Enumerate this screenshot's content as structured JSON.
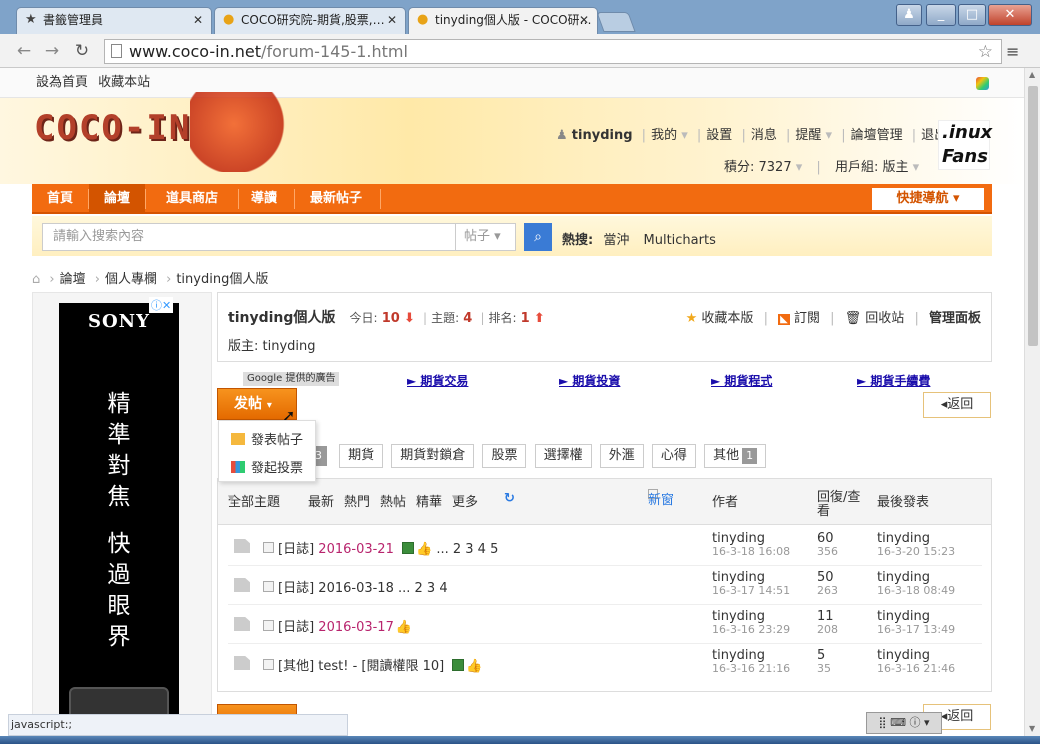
{
  "browser": {
    "tabs": [
      {
        "label": "書籤管理員",
        "icon": "star-icon"
      },
      {
        "label": "COCO研究院-期貨,股票,…",
        "icon": "coco-icon"
      },
      {
        "label": "tinyding個人版 - COCO研…",
        "icon": "coco-icon"
      }
    ],
    "url_host": "www.coco-in.net",
    "url_path": "/forum-145-1.html",
    "status_text": "javascript:;"
  },
  "topbar": {
    "set_home": "設為首頁",
    "bookmark": "收藏本站"
  },
  "header": {
    "logo": "COCO-IN",
    "user": "tinyding",
    "links": [
      "我的",
      "設置",
      "消息",
      "提醒",
      "論壇管理",
      "退出"
    ],
    "points": "積分: 7327",
    "group": "用戶組: 版主",
    "side_badge_1": ".inux",
    "side_badge_2": "Fans"
  },
  "nav": {
    "items": [
      "首頁",
      "論壇",
      "道具商店",
      "導讀",
      "最新帖子"
    ],
    "quick": "快捷導航"
  },
  "search": {
    "placeholder": "請輸入搜索內容",
    "type": "帖子",
    "hot_label": "熱搜:",
    "hot_items": [
      "當沖",
      "Multicharts"
    ]
  },
  "breadcrumb": [
    "論壇",
    "個人專欄",
    "tinyding個人版"
  ],
  "ad": {
    "brand": "SONY",
    "line1": [
      "精",
      "準",
      "對",
      "焦"
    ],
    "line2": [
      "快",
      "過",
      "眼",
      "界"
    ]
  },
  "forum": {
    "name": "tinyding個人版",
    "today_label": "今日:",
    "today": "10",
    "topics_label": "主題:",
    "topics": "4",
    "rank_label": "排名:",
    "rank": "1",
    "moderator": "版主: tinyding",
    "actions": [
      "收藏本版",
      "訂閱",
      "回收站",
      "管理面板"
    ]
  },
  "adlinks": {
    "google": "Google 提供的廣告",
    "links": [
      "► 期貨交易",
      "► 期貨投資",
      "► 期貨程式",
      "► 期貨手續費"
    ]
  },
  "post": {
    "button": "发帖",
    "return": "返回",
    "menu": [
      "發表帖子",
      "發起投票"
    ]
  },
  "type_tabs": [
    {
      "label": "期貨"
    },
    {
      "label": "期貨對鎖倉"
    },
    {
      "label": "股票"
    },
    {
      "label": "選擇權"
    },
    {
      "label": "外滙"
    },
    {
      "label": "心得"
    },
    {
      "label": "其他",
      "count": "1"
    }
  ],
  "hidden_tab_count": "3",
  "thread_header": {
    "filters": [
      "全部主題",
      "最新",
      "熱門",
      "熱帖",
      "精華",
      "更多"
    ],
    "new_window": "新窗",
    "author": "作者",
    "replies": "回復/查看",
    "last": "最後發表"
  },
  "threads": [
    {
      "cat": "[日誌]",
      "title": "2016-03-21",
      "highlight": true,
      "pics": true,
      "thumb": true,
      "pages": "... 2  3  4  5",
      "author": "tinyding",
      "time": "16-3-18 16:08",
      "replies": "60",
      "views": "356",
      "last_user": "tinyding",
      "last_time": "16-3-20 15:23"
    },
    {
      "cat": "[日誌]",
      "title": "2016-03-18",
      "highlight": false,
      "pics": false,
      "thumb": false,
      "pages": "... 2  3  4",
      "author": "tinyding",
      "time": "16-3-17 14:51",
      "replies": "50",
      "views": "263",
      "last_user": "tinyding",
      "last_time": "16-3-18 08:49"
    },
    {
      "cat": "[日誌]",
      "title": "2016-03-17",
      "highlight": true,
      "pics": false,
      "thumb": true,
      "pages": "",
      "author": "tinyding",
      "time": "16-3-16 23:29",
      "replies": "11",
      "views": "208",
      "last_user": "tinyding",
      "last_time": "16-3-17 13:49"
    },
    {
      "cat": "[其他]",
      "title": "test! - [閱讀權限 10]",
      "highlight": false,
      "pics": true,
      "thumb": true,
      "pages": "",
      "author": "tinyding",
      "time": "16-3-16 21:16",
      "replies": "5",
      "views": "35",
      "last_user": "tinyding",
      "last_time": "16-3-16 21:46"
    }
  ]
}
